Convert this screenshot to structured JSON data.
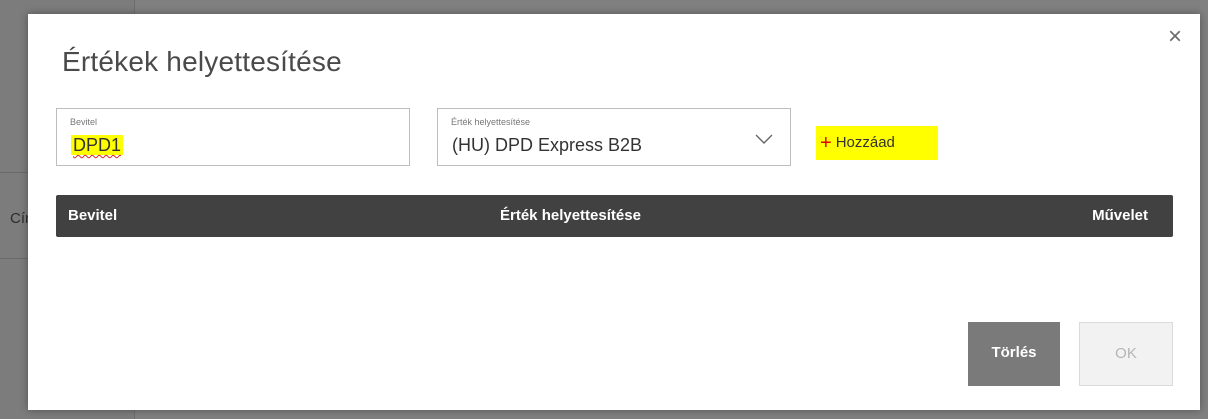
{
  "background": {
    "partial_text": "Cím"
  },
  "dialog": {
    "title": "Értékek helyettesítése",
    "close_symbol": "×",
    "input_field": {
      "label": "Bevitel",
      "value": "DPD1"
    },
    "replace_field": {
      "label": "Érték helyettesítése",
      "value": "(HU) DPD Express B2B"
    },
    "add_button": {
      "icon": "+",
      "label": "Hozzáad"
    },
    "table": {
      "columns": [
        "Bevitel",
        "Érték helyettesítése",
        "Művelet"
      ]
    },
    "buttons": {
      "delete_label": "Törlés",
      "ok_label": "OK"
    },
    "colors": {
      "highlight": "#ffff00",
      "header_bg": "#414141",
      "plus_icon": "#e00000"
    }
  }
}
